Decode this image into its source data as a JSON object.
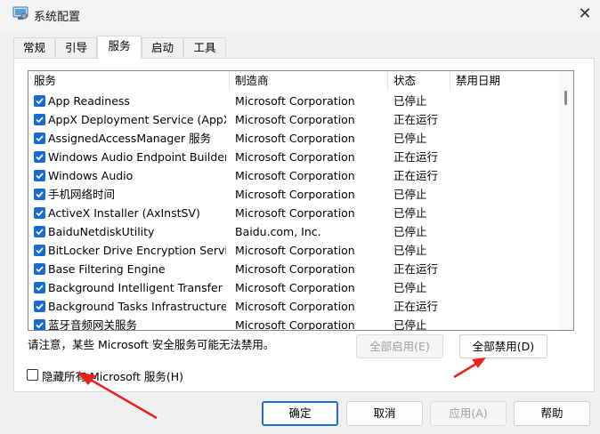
{
  "window": {
    "title": "系统配置",
    "close_glyph": "✕"
  },
  "tabs": [
    {
      "label": "常规",
      "active": false
    },
    {
      "label": "引导",
      "active": false
    },
    {
      "label": "服务",
      "active": true
    },
    {
      "label": "启动",
      "active": false
    },
    {
      "label": "工具",
      "active": false
    }
  ],
  "list": {
    "headers": [
      "服务",
      "制造商",
      "状态",
      "禁用日期"
    ],
    "rows": [
      {
        "checked": true,
        "service": "App Readiness",
        "vendor": "Microsoft Corporation",
        "status": "已停止",
        "disabled_date": ""
      },
      {
        "checked": true,
        "service": "AppX Deployment Service (AppX…",
        "vendor": "Microsoft Corporation",
        "status": "正在运行",
        "disabled_date": ""
      },
      {
        "checked": true,
        "service": "AssignedAccessManager 服务",
        "vendor": "Microsoft Corporation",
        "status": "已停止",
        "disabled_date": ""
      },
      {
        "checked": true,
        "service": "Windows Audio Endpoint Builder",
        "vendor": "Microsoft Corporation",
        "status": "正在运行",
        "disabled_date": ""
      },
      {
        "checked": true,
        "service": "Windows Audio",
        "vendor": "Microsoft Corporation",
        "status": "正在运行",
        "disabled_date": ""
      },
      {
        "checked": true,
        "service": "手机网络时间",
        "vendor": "Microsoft Corporation",
        "status": "已停止",
        "disabled_date": ""
      },
      {
        "checked": true,
        "service": "ActiveX Installer (AxInstSV)",
        "vendor": "Microsoft Corporation",
        "status": "已停止",
        "disabled_date": ""
      },
      {
        "checked": true,
        "service": "BaiduNetdiskUtility",
        "vendor": "Baidu.com, Inc.",
        "status": "已停止",
        "disabled_date": ""
      },
      {
        "checked": true,
        "service": "BitLocker Drive Encryption Service",
        "vendor": "Microsoft Corporation",
        "status": "已停止",
        "disabled_date": ""
      },
      {
        "checked": true,
        "service": "Base Filtering Engine",
        "vendor": "Microsoft Corporation",
        "status": "正在运行",
        "disabled_date": ""
      },
      {
        "checked": true,
        "service": "Background Intelligent Transfer …",
        "vendor": "Microsoft Corporation",
        "status": "已停止",
        "disabled_date": ""
      },
      {
        "checked": true,
        "service": "Background Tasks Infrastructure…",
        "vendor": "Microsoft Corporation",
        "status": "正在运行",
        "disabled_date": ""
      },
      {
        "checked": true,
        "service": "蓝牙音频网关服务",
        "vendor": "Microsoft Corporation",
        "status": "已停止",
        "disabled_date": ""
      }
    ]
  },
  "note": "请注意，某些 Microsoft 安全服务可能无法禁用。",
  "buttons": {
    "enable_all": "全部启用(E)",
    "disable_all": "全部禁用(D)",
    "ok": "确定",
    "cancel": "取消",
    "apply": "应用(A)",
    "help": "帮助"
  },
  "hide_ms_label": "隐藏所有 Microsoft 服务(H)",
  "hide_ms_checked": false,
  "colors": {
    "accent": "#1a6bd1",
    "annotation_arrow": "#e8231d"
  }
}
